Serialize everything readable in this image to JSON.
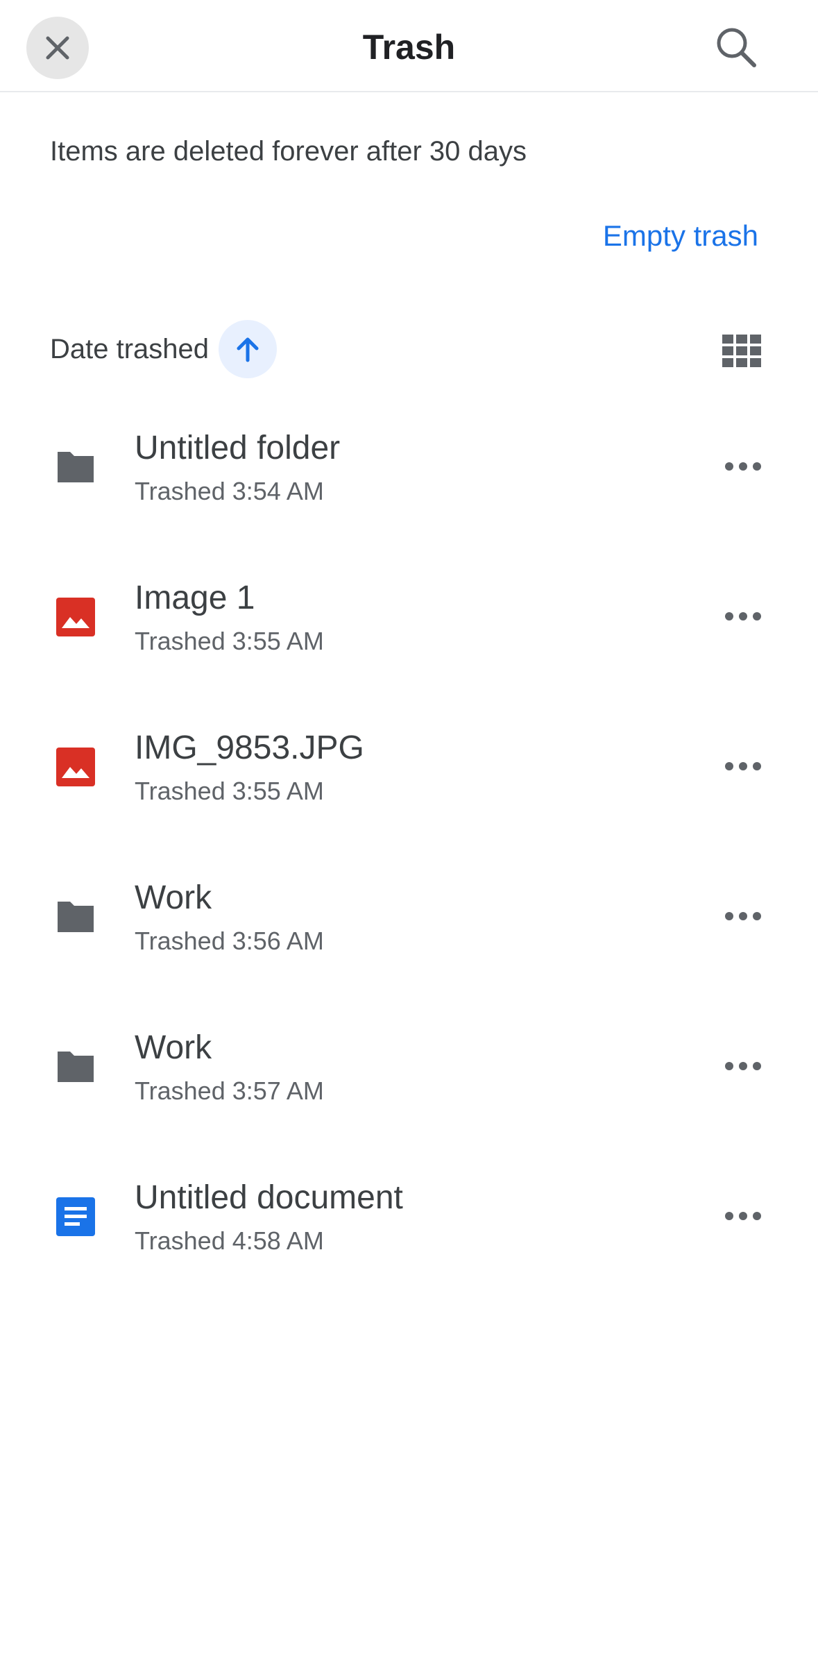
{
  "header": {
    "title": "Trash",
    "close_icon": "close-icon",
    "search_icon": "search-icon"
  },
  "notice": {
    "text": "Items are deleted forever after 30 days",
    "empty_trash_label": "Empty trash"
  },
  "sort": {
    "label": "Date trashed",
    "direction_icon": "arrow-up-icon",
    "view_toggle_icon": "grid-view-icon"
  },
  "items": [
    {
      "name": "Untitled folder",
      "meta": "Trashed 3:54 AM",
      "icon": "folder-icon"
    },
    {
      "name": "Image 1",
      "meta": "Trashed 3:55 AM",
      "icon": "image-icon"
    },
    {
      "name": "IMG_9853.JPG",
      "meta": "Trashed 3:55 AM",
      "icon": "image-icon"
    },
    {
      "name": "Work",
      "meta": "Trashed 3:56 AM",
      "icon": "folder-icon"
    },
    {
      "name": "Work",
      "meta": "Trashed 3:57 AM",
      "icon": "folder-icon"
    },
    {
      "name": "Untitled document",
      "meta": "Trashed 4:58 AM",
      "icon": "document-icon"
    }
  ],
  "colors": {
    "accent": "#1a73e8",
    "folder": "#5f6368",
    "image": "#d93025",
    "document": "#1a73e8",
    "sort_button_bg": "#e8f0fe"
  }
}
